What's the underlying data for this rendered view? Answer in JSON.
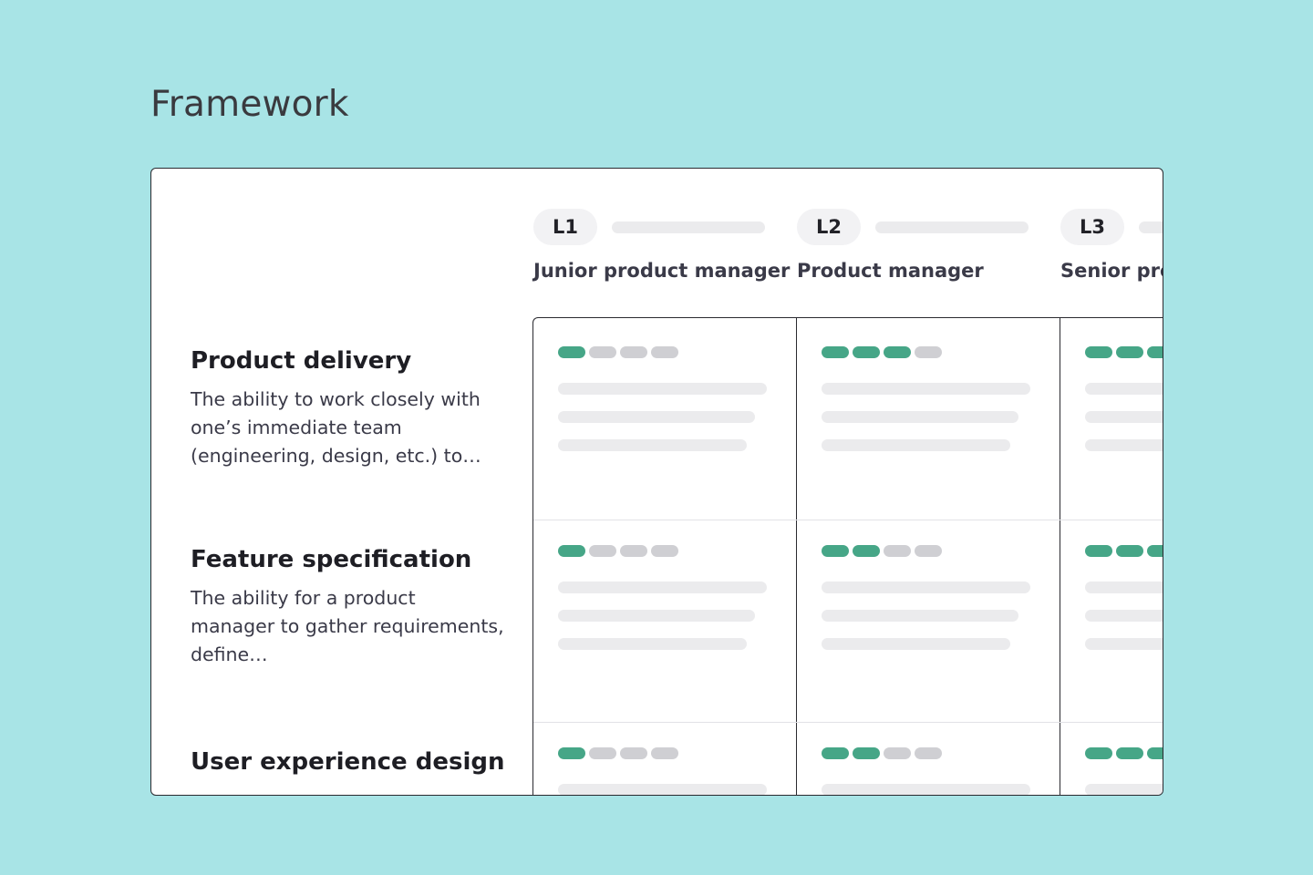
{
  "page": {
    "title": "Framework"
  },
  "colors": {
    "background": "#a8e4e6",
    "accent": "#46a687",
    "inactive": "#cfcfd3"
  },
  "levels": [
    {
      "level": "L1",
      "title": "Junior product manager"
    },
    {
      "level": "L2",
      "title": "Product manager"
    },
    {
      "level": "L3",
      "title": "Senior product manager"
    }
  ],
  "competencies": [
    {
      "name": "Product delivery",
      "description": "The ability to work closely with one’s immediate team (engineering, design, etc.) to…",
      "ratings": [
        1,
        3,
        3
      ]
    },
    {
      "name": "Feature specification",
      "description": "The ability for a product manager to gather requirements, define…",
      "ratings": [
        1,
        2,
        3
      ]
    },
    {
      "name": "User experience design",
      "description": "",
      "ratings": [
        1,
        2,
        3
      ]
    }
  ]
}
